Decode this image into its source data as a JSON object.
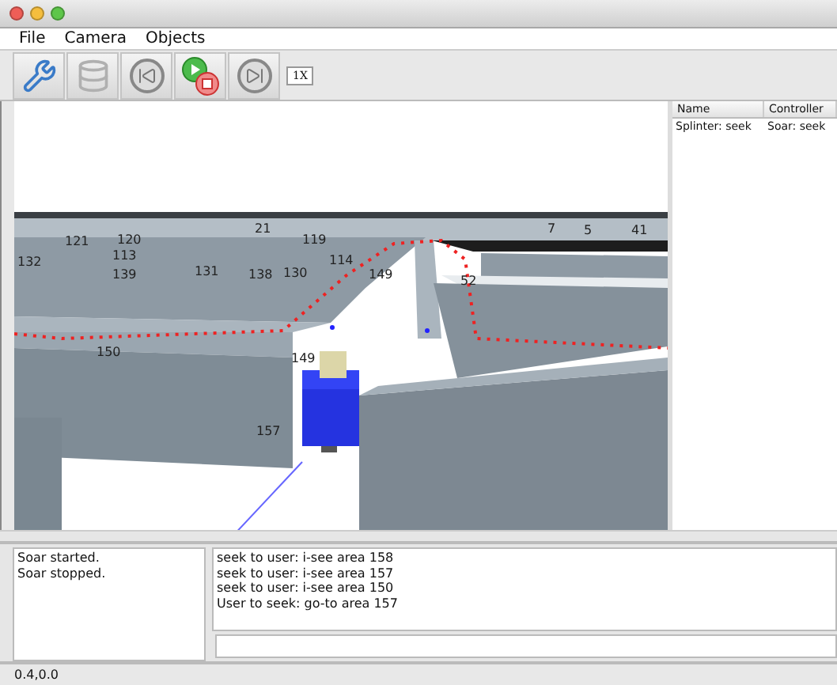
{
  "menu": [
    {
      "label": "File"
    },
    {
      "label": "Camera"
    },
    {
      "label": "Objects"
    }
  ],
  "toolbar": {
    "buttons": [
      {
        "kind": "tools",
        "disabled": false
      },
      {
        "kind": "database",
        "disabled": true
      },
      {
        "kind": "reset",
        "disabled": false
      },
      {
        "kind": "run-stop",
        "disabled": false
      },
      {
        "kind": "step",
        "disabled": false
      }
    ],
    "speed": "1X"
  },
  "scene": {
    "labels": [
      "132",
      "113",
      "139",
      "131",
      "138",
      "130",
      "119",
      "114",
      "149",
      "52",
      "150",
      "149",
      "157",
      "121",
      "120",
      "21",
      "7",
      "5",
      "41"
    ]
  },
  "agents": {
    "columns": [
      "Name",
      "Controller"
    ],
    "rows": [
      [
        "Splinter: seek",
        "Soar: seek"
      ]
    ]
  },
  "log": [
    "Soar started.",
    "Soar stopped."
  ],
  "chat": {
    "messages": [
      "seek to user: i-see area 158",
      "seek to user: i-see area 157",
      "seek to user: i-see area 150",
      "User to seek: go-to area 157"
    ]
  },
  "status_bar": "0.4,0.0"
}
